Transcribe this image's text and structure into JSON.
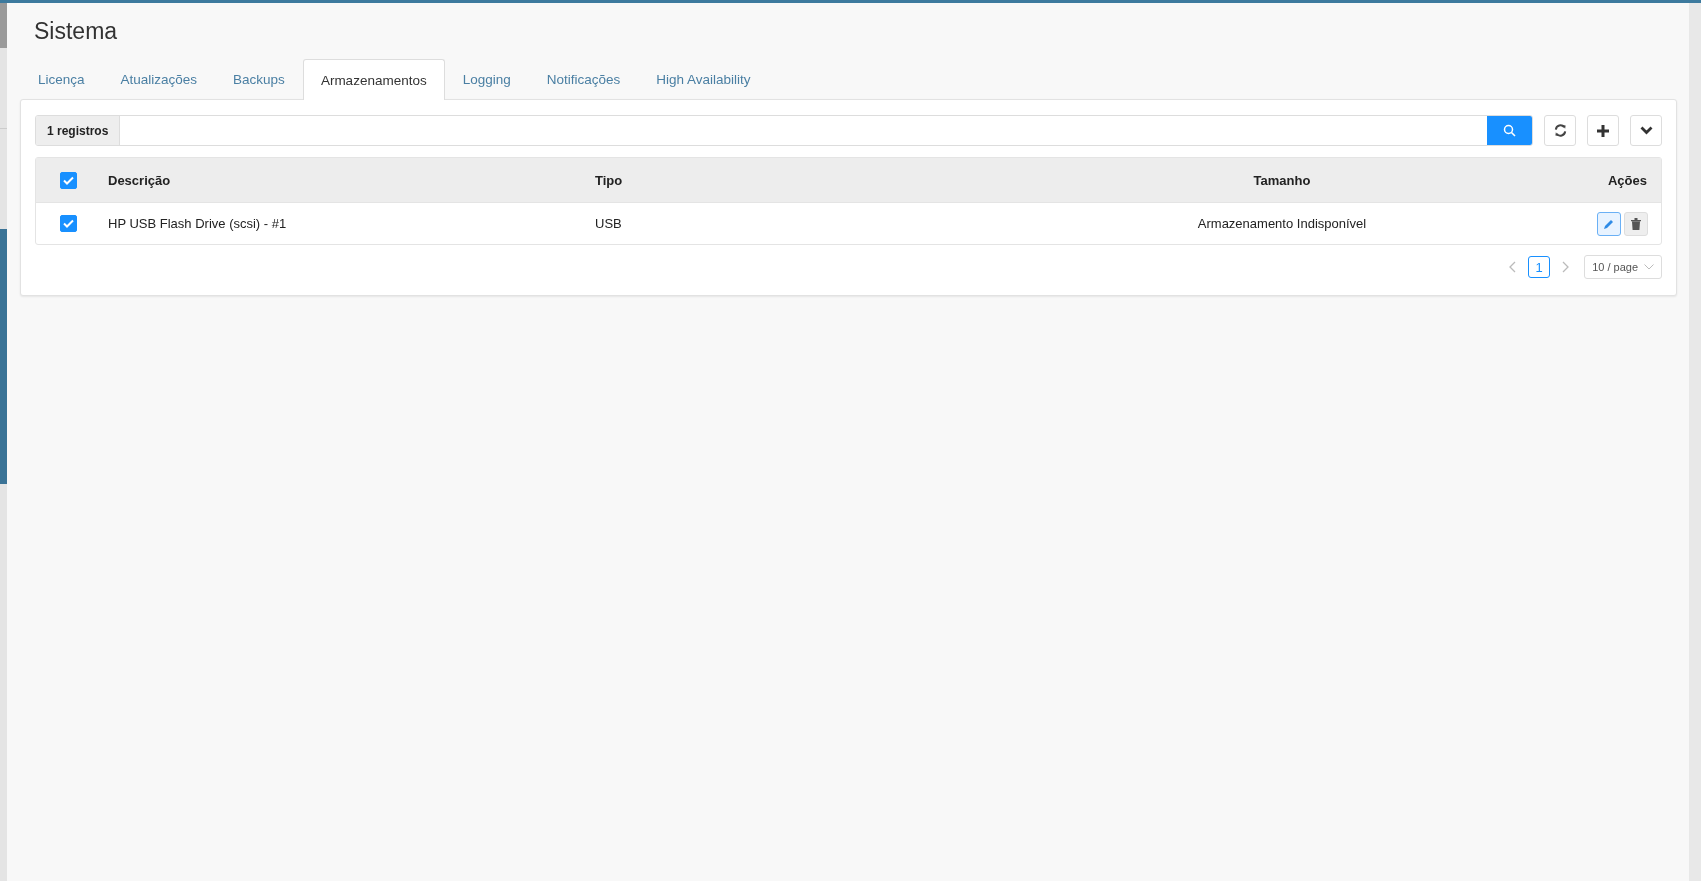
{
  "page": {
    "title": "Sistema"
  },
  "tabs": [
    {
      "label": "Licença",
      "selected": false
    },
    {
      "label": "Atualizações",
      "selected": false
    },
    {
      "label": "Backups",
      "selected": false
    },
    {
      "label": "Armazenamentos",
      "selected": true
    },
    {
      "label": "Logging",
      "selected": false
    },
    {
      "label": "Notificações",
      "selected": false
    },
    {
      "label": "High Availability",
      "selected": false
    }
  ],
  "toolbar": {
    "record_count": "1 registros"
  },
  "table": {
    "all_checked": true,
    "columns": [
      "Descrição",
      "Tipo",
      "Tamanho",
      "Ações"
    ],
    "rows": [
      {
        "checked": true,
        "cells": [
          "HP USB Flash Drive (scsi) - #1",
          "USB",
          "Armazenamento Indisponível"
        ]
      }
    ]
  },
  "pagination": {
    "pages": [
      {
        "label": "1",
        "selected": true
      }
    ],
    "page_size": "10 / page"
  }
}
